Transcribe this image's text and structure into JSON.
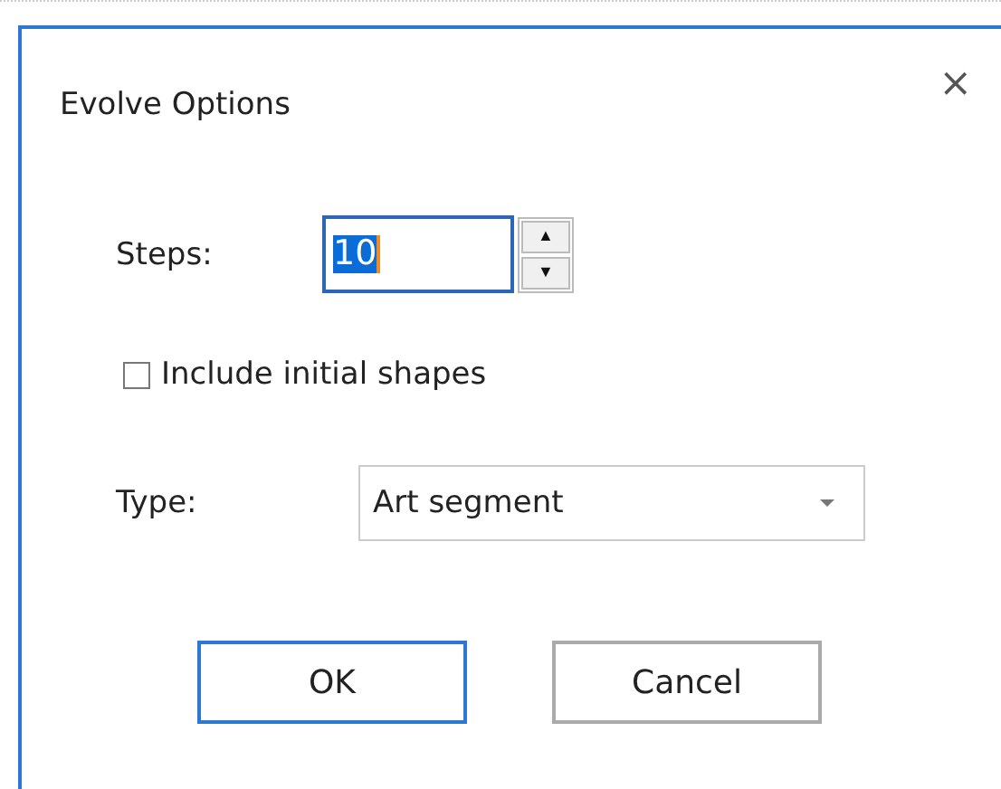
{
  "window": {
    "title": "Evolve Options",
    "close": "×"
  },
  "steps": {
    "label": "Steps:",
    "value": "10",
    "up": "▲",
    "down": "▼"
  },
  "include_initial_shapes": {
    "label": "Include initial shapes",
    "checked": false
  },
  "type": {
    "label": "Type:",
    "value": "Art segment"
  },
  "buttons": [
    {
      "label": "OK",
      "default": true
    },
    {
      "label": "Cancel",
      "default": false
    }
  ]
}
